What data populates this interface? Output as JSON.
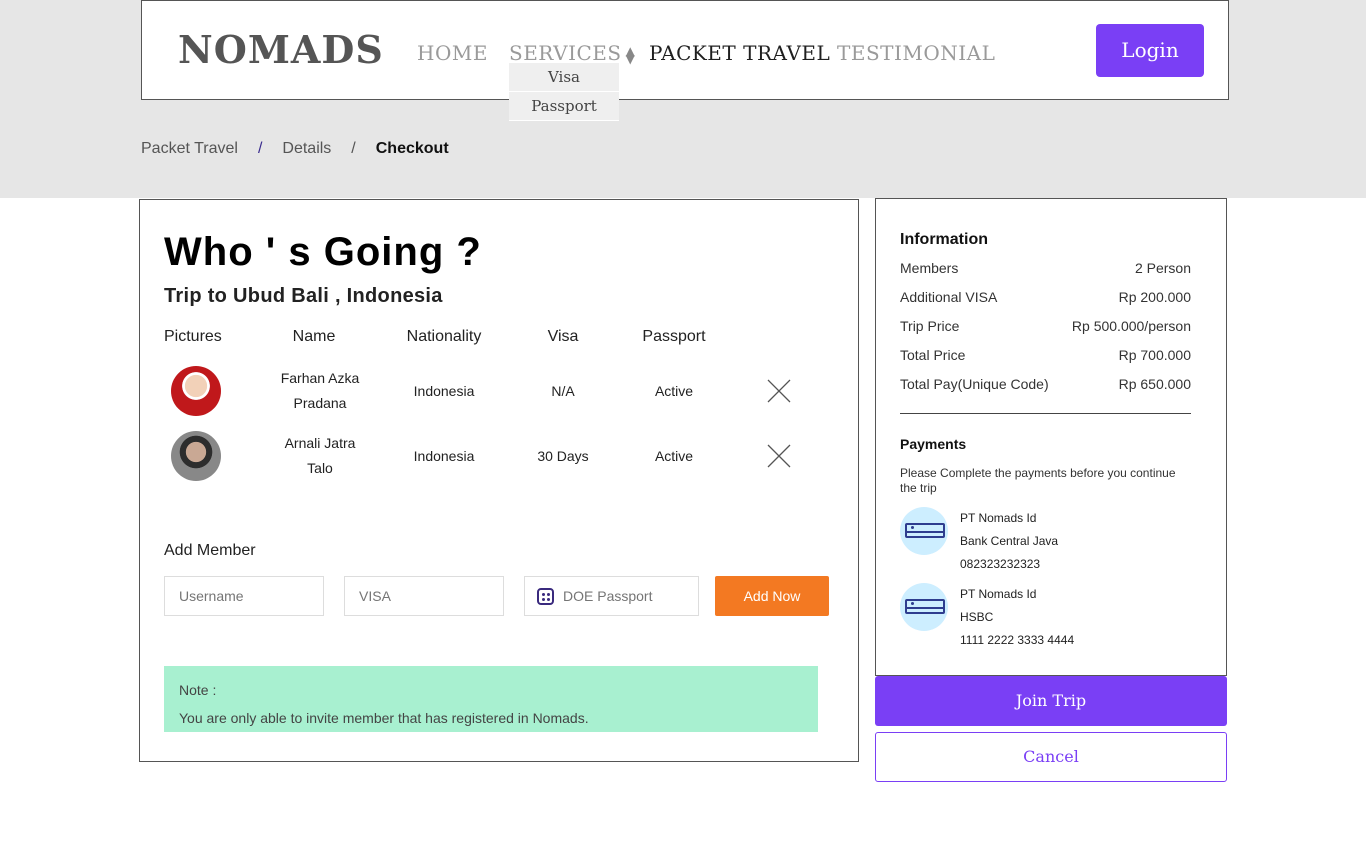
{
  "brand": {
    "logo": "NOMADS",
    "accent_color": "#7a3ff5",
    "orange": "#f37922",
    "note_bg": "#a8f0d0"
  },
  "nav": {
    "home": "HOME",
    "services": "SERVICES",
    "packet_travel": "PACKET TRAVEL",
    "testimonial": "TESTIMONIAL",
    "dropdown": [
      "Visa",
      "Passport"
    ],
    "login": "Login"
  },
  "breadcrumb": {
    "items": [
      "Packet Travel",
      "Details",
      "Checkout"
    ],
    "separator": "/"
  },
  "main": {
    "title": "Who ' s Going ?",
    "subtitle": "Trip to Ubud Bali , Indonesia",
    "columns": [
      "Pictures",
      "Name",
      "Nationality",
      "Visa",
      "Passport"
    ],
    "members": [
      {
        "name_line1": "Farhan Azka",
        "name_line2": "Pradana",
        "nationality": "Indonesia",
        "visa": "N/A",
        "passport": "Active"
      },
      {
        "name_line1": "Arnali Jatra",
        "name_line2": "Talo",
        "nationality": "Indonesia",
        "visa": "30 Days",
        "passport": "Active"
      }
    ],
    "add_member": {
      "label": "Add Member",
      "username_placeholder": "Username",
      "visa_placeholder": "VISA",
      "doe_placeholder": "DOE Passport",
      "button": "Add Now"
    },
    "note": {
      "heading": "Note :",
      "text": "You are only able to invite member that has registered in Nomads."
    }
  },
  "info": {
    "title": "Information",
    "rows": [
      {
        "label": "Members",
        "value": "2 Person"
      },
      {
        "label": "Additional VISA",
        "value": "Rp 200.000"
      },
      {
        "label": "Trip Price",
        "value": "Rp 500.000/person"
      },
      {
        "label": "Total Price",
        "value": "Rp 700.000"
      },
      {
        "label": "Total Pay(Unique Code)",
        "value": "Rp 650.000"
      }
    ],
    "payments_title": "Payments",
    "payments_desc": "Please Complete the payments before you continue the trip",
    "banks": [
      {
        "holder": "PT Nomads Id",
        "bank": "Bank Central Java",
        "account": "082323232323"
      },
      {
        "holder": "PT Nomads Id",
        "bank": "HSBC",
        "account": "1111 2222 3333 4444"
      }
    ]
  },
  "actions": {
    "join": "Join Trip",
    "cancel": "Cancel"
  }
}
